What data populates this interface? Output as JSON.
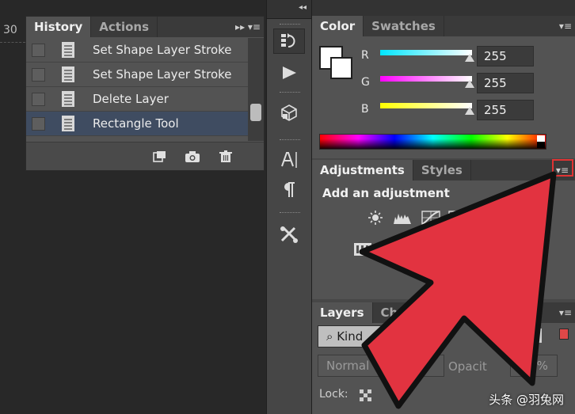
{
  "ruler": {
    "value": "30"
  },
  "history_panel": {
    "tabs": [
      {
        "label": "History",
        "active": true
      },
      {
        "label": "Actions",
        "active": false
      }
    ],
    "menu_glyph": "▸▸ ▾≡",
    "items": [
      {
        "label": "Set Shape Layer Stroke",
        "selected": false
      },
      {
        "label": "Set Shape Layer Stroke",
        "selected": false
      },
      {
        "label": "Delete Layer",
        "selected": false
      },
      {
        "label": "Rectangle Tool",
        "selected": true
      }
    ],
    "scroll_position": 0.72
  },
  "midcolumn": {
    "collapse_glyph": "◂◂",
    "icons": [
      "history-brush-icon",
      "play-icon",
      "cube-icon",
      "character-icon",
      "paragraph-icon",
      "tools-icon"
    ]
  },
  "color_panel": {
    "tabs": [
      {
        "label": "Color",
        "active": true
      },
      {
        "label": "Swatches",
        "active": false
      }
    ],
    "channels": [
      {
        "label": "R",
        "value": "255",
        "color": "#00e5ff"
      },
      {
        "label": "G",
        "value": "255",
        "color": "#ff00ff"
      },
      {
        "label": "B",
        "value": "255",
        "color": "#ffff00"
      }
    ]
  },
  "adjustments_panel": {
    "tabs": [
      {
        "label": "Adjustments",
        "active": true
      },
      {
        "label": "Styles",
        "active": false
      }
    ],
    "title": "Add an adjustment"
  },
  "layers_panel": {
    "tabs": [
      {
        "label": "Layers",
        "active": true
      },
      {
        "label": "Channe",
        "active": false
      }
    ],
    "filter": "Kind",
    "blend_mode": "Normal",
    "opacity_label": "Opacit",
    "opacity_value": "100%",
    "lock_label": "Lock:"
  },
  "watermark": "头条 @羽兔网",
  "colors": {
    "highlight": "#e03333",
    "arrow": "#e23340",
    "selection": "#3f4c61"
  }
}
